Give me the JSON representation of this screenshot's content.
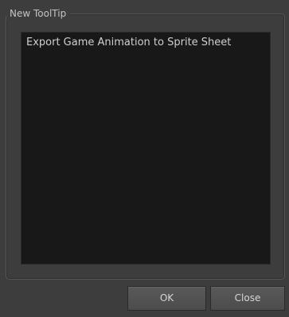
{
  "group": {
    "title": "New ToolTip"
  },
  "tooltip_text": {
    "value": "Export Game Animation to Sprite Sheet"
  },
  "buttons": {
    "ok_label": "OK",
    "close_label": "Close"
  }
}
